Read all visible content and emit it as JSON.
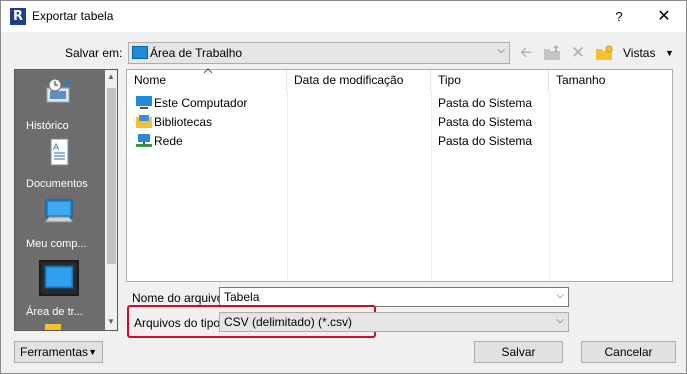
{
  "window": {
    "app_icon_letter": "R",
    "title": "Exportar tabela",
    "help": "?",
    "close": "✕"
  },
  "save_in": {
    "label": "Salvar em:",
    "value": "Área de Trabalho"
  },
  "toolbar": {
    "views_label": "Vistas"
  },
  "places": [
    {
      "label": "Histórico",
      "icon": "history-icon"
    },
    {
      "label": "Documentos",
      "icon": "documents-icon"
    },
    {
      "label": "Meu comp...",
      "icon": "my-computer-icon"
    },
    {
      "label": "Área de tr...",
      "icon": "desktop-icon",
      "selected": true
    }
  ],
  "file_list": {
    "columns": [
      "Nome",
      "Data de modificação",
      "Tipo",
      "Tamanho"
    ],
    "rows": [
      {
        "name": "Este Computador",
        "modified": "",
        "type": "Pasta do Sistema",
        "size": "",
        "icon": "computer-icon"
      },
      {
        "name": "Bibliotecas",
        "modified": "",
        "type": "Pasta do Sistema",
        "size": "",
        "icon": "libraries-icon"
      },
      {
        "name": "Rede",
        "modified": "",
        "type": "Pasta do Sistema",
        "size": "",
        "icon": "network-icon"
      }
    ]
  },
  "file_name": {
    "label": "Nome do arquivo:",
    "value": "Tabela"
  },
  "file_type": {
    "label": "Arquivos do tipo:",
    "value": "CSV (delimitado)  (*.csv)"
  },
  "buttons": {
    "tools": "Ferramentas",
    "save": "Salvar",
    "cancel": "Cancelar"
  },
  "colors": {
    "highlight": "#c8102e",
    "places_bg": "#6d6d6d"
  }
}
